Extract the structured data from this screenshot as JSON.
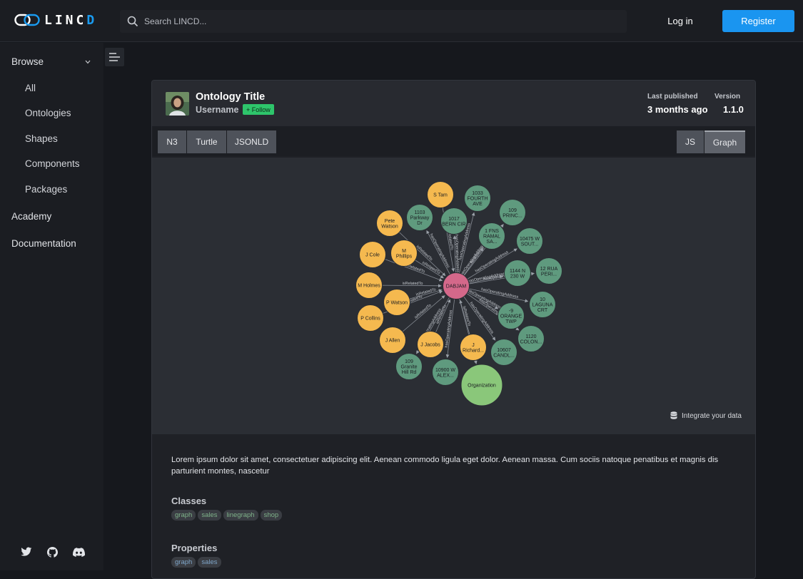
{
  "header": {
    "logo_text_a": "LINC",
    "logo_text_b": "D",
    "search_placeholder": "Search LINCD...",
    "login_label": "Log in",
    "register_label": "Register"
  },
  "sidebar": {
    "browse_label": "Browse",
    "sub_items": [
      "All",
      "Ontologies",
      "Shapes",
      "Components",
      "Packages"
    ],
    "academy_label": "Academy",
    "documentation_label": "Documentation",
    "social_icons": [
      "twitter-icon",
      "github-icon",
      "discord-icon"
    ]
  },
  "card": {
    "title": "Ontology Title",
    "username": "Username",
    "follow_label": "+ Follow",
    "last_published_label": "Last published",
    "last_published_value": "3 months ago",
    "version_label": "Version",
    "version_value": "1.1.0",
    "format_tabs": [
      "N3",
      "Turtle",
      "JSONLD"
    ],
    "view_tabs": [
      "JS",
      "Graph"
    ],
    "active_view": "Graph",
    "integrate_label": "Integrate your data",
    "description": "Lorem ipsum dolor sit amet, consectetuer adipiscing elit. Aenean commodo ligula eget dolor. Aenean massa. Cum sociis natoque penatibus et magnis dis parturient montes, nascetur",
    "classes_title": "Classes",
    "classes": [
      "graph",
      "sales",
      "linegraph",
      "shop"
    ],
    "properties_title": "Properties",
    "properties": [
      "graph",
      "sales"
    ]
  },
  "graph": {
    "center": "DABJAM",
    "people": [
      "S Tam",
      "Pete Watson",
      "J Cole",
      "M Phillips",
      "M Holmes",
      "P Watson",
      "P Collins",
      "J Allen",
      "J Jacobs",
      "J Richard..."
    ],
    "addresses": [
      "1033 FOURTH AVE",
      "109 PRINC...",
      "1103 Parkway Dr",
      "1017 BERN CIR",
      "1 FNS RAMAL SA...",
      "10475 W SOUT...",
      "12 RUA PERI...",
      "1144 N 230 W",
      "10 LAGUNA CRT",
      "-9 ORANGE TWP",
      "1120 COLON...",
      "10607 CANDL...",
      "109 Granite Hill Rd",
      "10900 W ALEX..."
    ],
    "organization": "Organization",
    "edge_labels": [
      "isRelatedTo",
      "hasOperatingAddress"
    ],
    "colors": {
      "person": "#f5b94f",
      "address": "#5f9a7e",
      "center": "#d4688a",
      "org": "#8ac77a"
    }
  }
}
